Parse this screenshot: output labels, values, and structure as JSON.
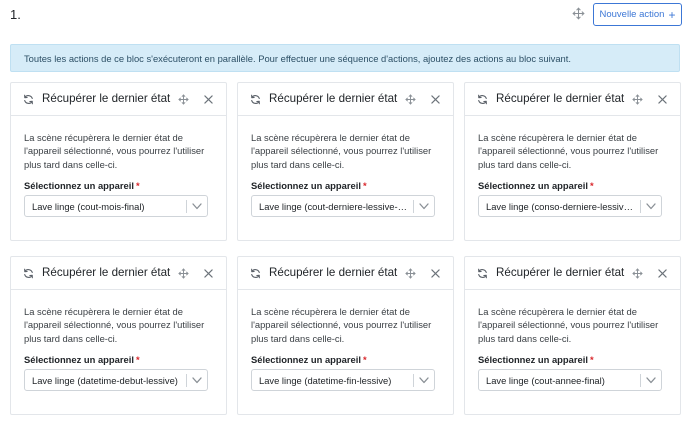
{
  "header": {
    "block_number": "1.",
    "new_action_label": "Nouvelle action",
    "new_action_icon": "plus-icon"
  },
  "alert": {
    "text": "Toutes les actions de ce bloc s'exécuteront en parallèle. Pour effectuer une séquence d'actions, ajoutez des actions au bloc suivant."
  },
  "cards": [
    {
      "title": "Récupérer le dernier état",
      "description": "La scène récupèrera le dernier état de l'appareil sélectionné, vous pourrez l'utiliser plus tard dans celle-ci.",
      "select_label": "Sélectionnez un appareil",
      "required_mark": "*",
      "selected_value": "Lave linge (cout-mois-final)"
    },
    {
      "title": "Récupérer le dernier état",
      "description": "La scène récupèrera le dernier état de l'appareil sélectionné, vous pourrez l'utiliser plus tard dans celle-ci.",
      "select_label": "Sélectionnez un appareil",
      "required_mark": "*",
      "selected_value": "Lave linge (cout-derniere-lessive-se…"
    },
    {
      "title": "Récupérer le dernier état",
      "description": "La scène récupèrera le dernier état de l'appareil sélectionné, vous pourrez l'utiliser plus tard dans celle-ci.",
      "select_label": "Sélectionnez un appareil",
      "required_mark": "*",
      "selected_value": "Lave linge (conso-derniere-lessive-…"
    },
    {
      "title": "Récupérer le dernier état",
      "description": "La scène récupèrera le dernier état de l'appareil sélectionné, vous pourrez l'utiliser plus tard dans celle-ci.",
      "select_label": "Sélectionnez un appareil",
      "required_mark": "*",
      "selected_value": "Lave linge (datetime-debut-lessive)"
    },
    {
      "title": "Récupérer le dernier état",
      "description": "La scène récupèrera le dernier état de l'appareil sélectionné, vous pourrez l'utiliser plus tard dans celle-ci.",
      "select_label": "Sélectionnez un appareil",
      "required_mark": "*",
      "selected_value": "Lave linge (datetime-fin-lessive)"
    },
    {
      "title": "Récupérer le dernier état",
      "description": "La scène récupèrera le dernier état de l'appareil sélectionné, vous pourrez l'utiliser plus tard dans celle-ci.",
      "select_label": "Sélectionnez un appareil",
      "required_mark": "*",
      "selected_value": "Lave linge (cout-annee-final)"
    }
  ],
  "icons": {
    "card_icon": "refresh-icon",
    "move": "move-icon",
    "close": "close-icon",
    "dropdown": "chevron-down-icon"
  },
  "colors": {
    "primary": "#3c77d6",
    "alert_bg": "#d6ecf8",
    "required": "#d9262b",
    "border": "#e3e6ea"
  }
}
